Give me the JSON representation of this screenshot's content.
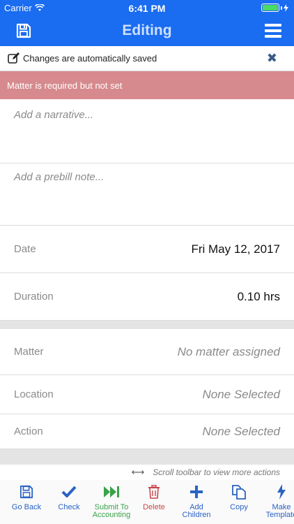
{
  "status_bar": {
    "carrier": "Carrier",
    "time": "6:41 PM",
    "battery_level": 1.0
  },
  "nav": {
    "title": "Editing",
    "save_icon": "floppy-disk-icon",
    "menu_icon": "hamburger-menu-icon"
  },
  "notice": {
    "text": "Changes are automatically saved",
    "edit_icon": "edit-icon",
    "close_icon": "close-icon"
  },
  "error": {
    "text": "Matter is required but not set"
  },
  "narrative": {
    "placeholder": "Add a narrative..."
  },
  "prebill": {
    "placeholder": "Add a prebill note..."
  },
  "fields": {
    "date": {
      "label": "Date",
      "value": "Fri May 12, 2017"
    },
    "duration": {
      "label": "Duration",
      "value": "0.10 hrs"
    },
    "matter": {
      "label": "Matter",
      "value": "No matter assigned"
    },
    "location": {
      "label": "Location",
      "value": "None Selected"
    },
    "action": {
      "label": "Action",
      "value": "None Selected"
    }
  },
  "hint": {
    "text": "Scroll toolbar to view more actions",
    "icon": "horizontal-arrows-icon"
  },
  "toolbar": {
    "items": [
      {
        "label": "Go Back",
        "icon": "floppy-disk-icon",
        "color": "#2a63c3"
      },
      {
        "label": "Check",
        "icon": "checkmark-icon",
        "color": "#2a63c3"
      },
      {
        "label": "Submit To Accounting",
        "icon": "fast-forward-icon",
        "color": "#3aa24a"
      },
      {
        "label": "Delete",
        "icon": "trash-icon",
        "color": "#c9464c"
      },
      {
        "label": "Add Children",
        "icon": "plus-icon",
        "color": "#2a63c3"
      },
      {
        "label": "Copy",
        "icon": "copy-icon",
        "color": "#2a63c3"
      },
      {
        "label": "Make Template",
        "icon": "lightning-icon",
        "color": "#2a63c3"
      }
    ]
  },
  "colors": {
    "primary": "#1a6cf0",
    "error_bg": "#d68a8d",
    "blue": "#2a63c3",
    "green": "#3aa24a",
    "red": "#c9464c"
  }
}
